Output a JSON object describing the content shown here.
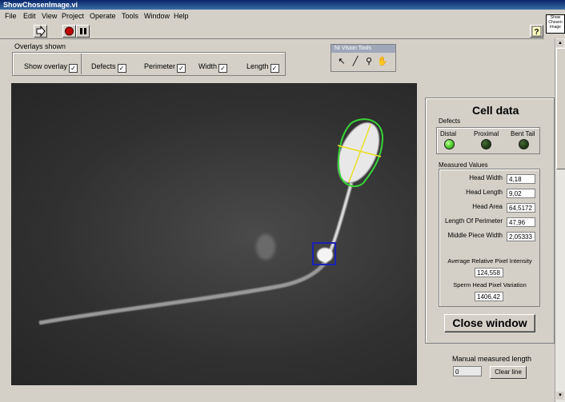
{
  "window": {
    "title": "ShowChosenImage.vi"
  },
  "menu": [
    "File",
    "Edit",
    "View",
    "Project",
    "Operate",
    "Tools",
    "Window",
    "Help"
  ],
  "vi_icon_text": [
    "Show",
    "Chosen",
    "Image"
  ],
  "overlays": {
    "label": "Overlays shown",
    "items": [
      {
        "label": "Show overlay",
        "checked": true
      },
      {
        "label": "Defects",
        "checked": true
      },
      {
        "label": "Perimeter",
        "checked": true
      },
      {
        "label": "Width",
        "checked": true
      },
      {
        "label": "Length",
        "checked": true
      }
    ],
    "check_glyph": "✓"
  },
  "ni_tools": {
    "title": "NI Vision Tools"
  },
  "cell": {
    "title": "Cell data",
    "defects_label": "Defects",
    "defects": [
      {
        "label": "Distal",
        "on": true
      },
      {
        "label": "Proximal",
        "on": false
      },
      {
        "label": "Bent Tail",
        "on": false
      }
    ],
    "measured_label": "Measured Values",
    "measures": [
      {
        "label": "Head Width",
        "value": "4,18"
      },
      {
        "label": "Head Length",
        "value": "9,02"
      },
      {
        "label": "Head Area",
        "value": "64,5172"
      },
      {
        "label": "Length Of Perimeter",
        "value": "47,96"
      },
      {
        "label": "Middle Piece Width",
        "value": "2,05333"
      }
    ],
    "avg_label": "Average Relative Pixel Intensity",
    "avg_value": "124,558",
    "var_label": "Sperm Head Pixel Variation",
    "var_value": "1406,42"
  },
  "close_label": "Close window",
  "manual": {
    "label": "Manual measured length",
    "value": "0",
    "clear_label": "Clear line"
  },
  "colors": {
    "led_on": "#4ccc2a",
    "led_off": "#1f3a14",
    "overlay_green": "#39d339",
    "overlay_yellow": "#e8e020",
    "roi_blue": "#1a20b8"
  }
}
